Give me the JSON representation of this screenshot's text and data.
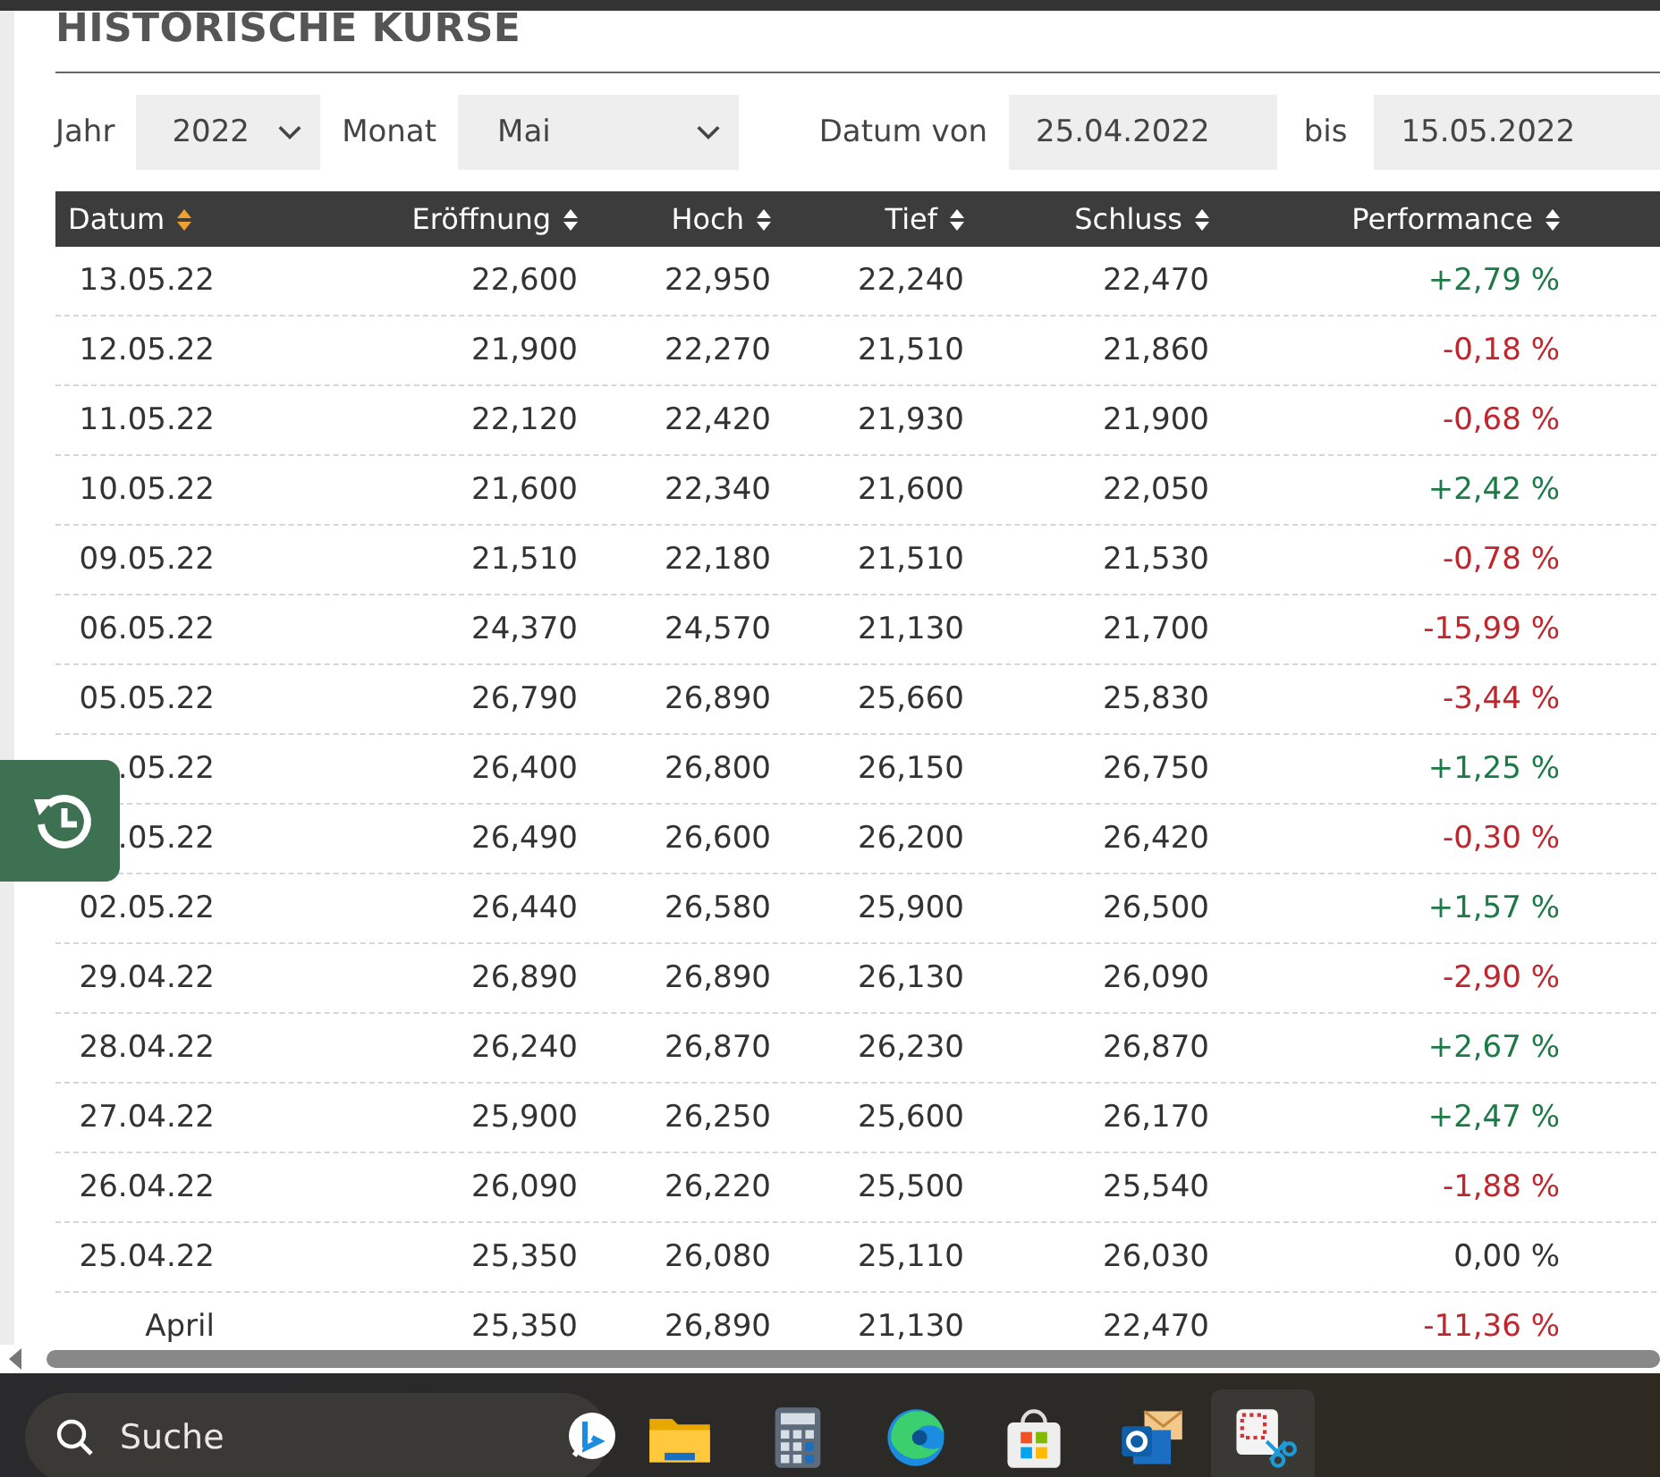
{
  "title": "HISTORISCHE KURSE",
  "filters": {
    "year_label": "Jahr",
    "year": "2022",
    "month_label": "Monat",
    "month": "Mai",
    "from_label": "Datum von",
    "from": "25.04.2022",
    "to_label": "bis",
    "to": "15.05.2022"
  },
  "table": {
    "columns": [
      {
        "label": "Datum",
        "sorted": true
      },
      {
        "label": "Eröffnung",
        "sorted": false
      },
      {
        "label": "Hoch",
        "sorted": false
      },
      {
        "label": "Tief",
        "sorted": false
      },
      {
        "label": "Schluss",
        "sorted": false
      },
      {
        "label": "Performance",
        "sorted": false
      }
    ],
    "rows": [
      {
        "date": "13.05.22",
        "open": "22,600",
        "high": "22,950",
        "low": "22,240",
        "close": "22,470",
        "performance": "+2,79 %",
        "color": "#1b7a45"
      },
      {
        "date": "12.05.22",
        "open": "21,900",
        "high": "22,270",
        "low": "21,510",
        "close": "21,860",
        "performance": "-0,18 %",
        "color": "#c0262d"
      },
      {
        "date": "11.05.22",
        "open": "22,120",
        "high": "22,420",
        "low": "21,930",
        "close": "21,900",
        "performance": "-0,68 %",
        "color": "#c0262d"
      },
      {
        "date": "10.05.22",
        "open": "21,600",
        "high": "22,340",
        "low": "21,600",
        "close": "22,050",
        "performance": "+2,42 %",
        "color": "#1b7a45"
      },
      {
        "date": "09.05.22",
        "open": "21,510",
        "high": "22,180",
        "low": "21,510",
        "close": "21,530",
        "performance": "-0,78 %",
        "color": "#c0262d"
      },
      {
        "date": "06.05.22",
        "open": "24,370",
        "high": "24,570",
        "low": "21,130",
        "close": "21,700",
        "performance": "-15,99 %",
        "color": "#c0262d"
      },
      {
        "date": "05.05.22",
        "open": "26,790",
        "high": "26,890",
        "low": "25,660",
        "close": "25,830",
        "performance": "-3,44 %",
        "color": "#c0262d"
      },
      {
        "date": ".05.22",
        "open": "26,400",
        "high": "26,800",
        "low": "26,150",
        "close": "26,750",
        "performance": "+1,25 %",
        "color": "#1b7a45"
      },
      {
        "date": ".05.22",
        "open": "26,490",
        "high": "26,600",
        "low": "26,200",
        "close": "26,420",
        "performance": "-0,30 %",
        "color": "#c0262d"
      },
      {
        "date": "02.05.22",
        "open": "26,440",
        "high": "26,580",
        "low": "25,900",
        "close": "26,500",
        "performance": "+1,57 %",
        "color": "#1b7a45"
      },
      {
        "date": "29.04.22",
        "open": "26,890",
        "high": "26,890",
        "low": "26,130",
        "close": "26,090",
        "performance": "-2,90 %",
        "color": "#c0262d"
      },
      {
        "date": "28.04.22",
        "open": "26,240",
        "high": "26,870",
        "low": "26,230",
        "close": "26,870",
        "performance": "+2,67 %",
        "color": "#1b7a45"
      },
      {
        "date": "27.04.22",
        "open": "25,900",
        "high": "26,250",
        "low": "25,600",
        "close": "26,170",
        "performance": "+2,47 %",
        "color": "#1b7a45"
      },
      {
        "date": "26.04.22",
        "open": "26,090",
        "high": "26,220",
        "low": "25,500",
        "close": "25,540",
        "performance": "-1,88 %",
        "color": "#c0262d"
      },
      {
        "date": "25.04.22",
        "open": "25,350",
        "high": "26,080",
        "low": "25,110",
        "close": "26,030",
        "performance": "0,00 %",
        "color": "#333333"
      },
      {
        "date": "April",
        "open": "25,350",
        "high": "26,890",
        "low": "21,130",
        "close": "22,470",
        "performance": "-11,36 %",
        "color": "#c0262d"
      }
    ]
  },
  "taskbar": {
    "search_placeholder": "Suche"
  }
}
